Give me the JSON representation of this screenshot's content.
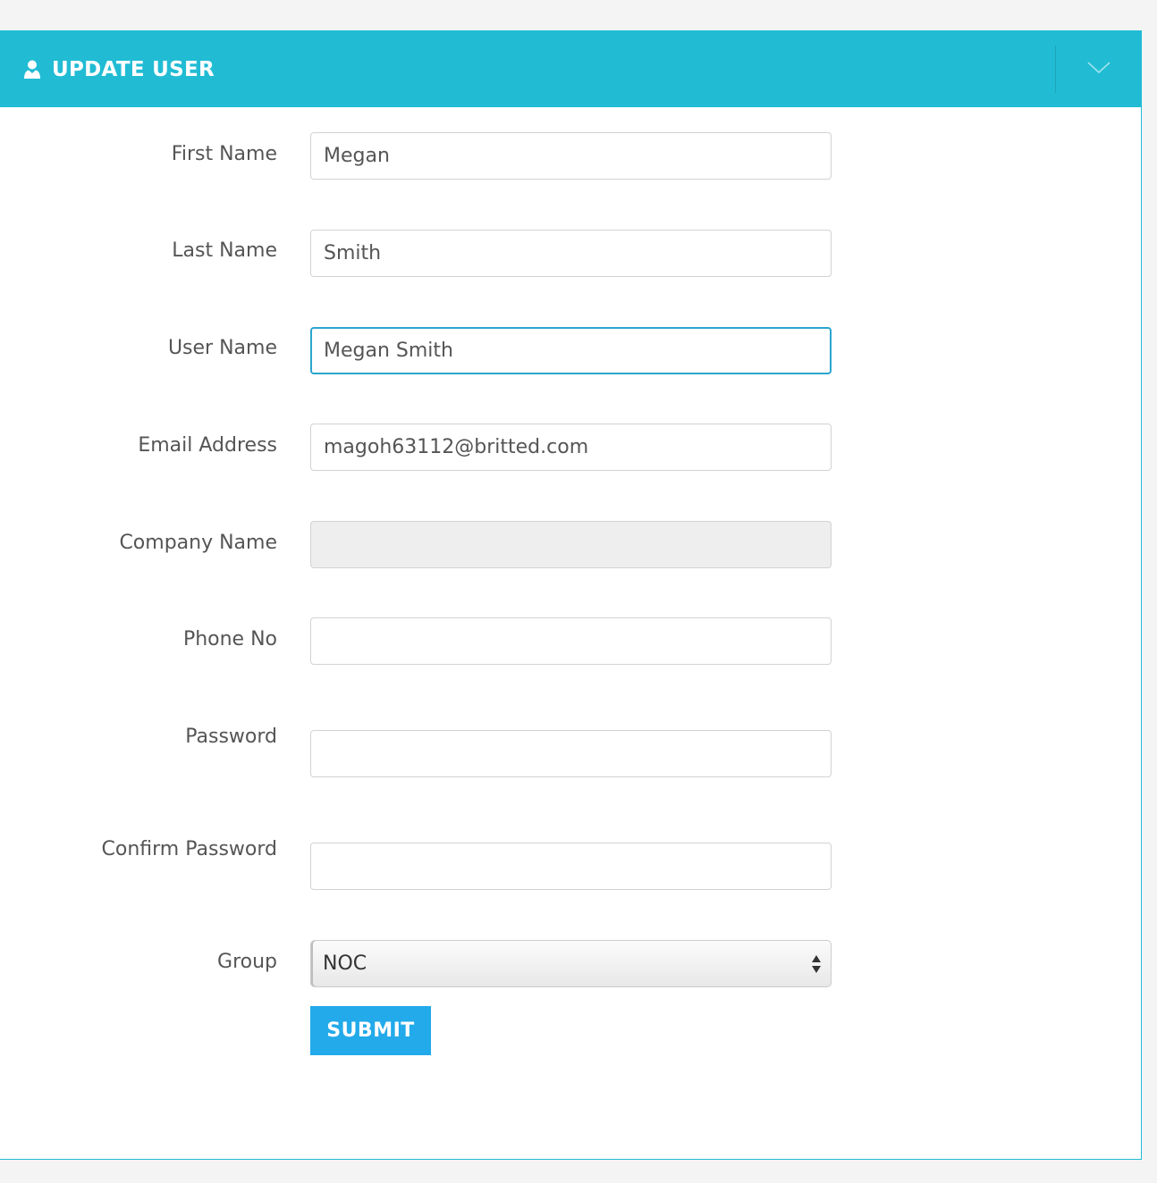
{
  "header": {
    "title": "UPDATE USER",
    "icon": "user-icon",
    "toggle_icon": "chevron-down-icon"
  },
  "colors": {
    "header_bg": "#21bcd4",
    "submit_bg": "#22aaea",
    "focus_border": "#2aa5cf"
  },
  "form": {
    "first_name": {
      "label": "First Name",
      "value": "Megan"
    },
    "last_name": {
      "label": "Last Name",
      "value": "Smith"
    },
    "user_name": {
      "label": "User Name",
      "value": "Megan Smith"
    },
    "email": {
      "label": "Email Address",
      "value": "magoh63112@britted.com"
    },
    "company": {
      "label": "Company Name",
      "value": ""
    },
    "phone": {
      "label": "Phone No",
      "value": ""
    },
    "password": {
      "label": "Password",
      "value": ""
    },
    "confirm_password": {
      "label": "Confirm Password",
      "value": ""
    },
    "group": {
      "label": "Group",
      "value": "NOC"
    },
    "submit_label": "SUBMIT"
  }
}
